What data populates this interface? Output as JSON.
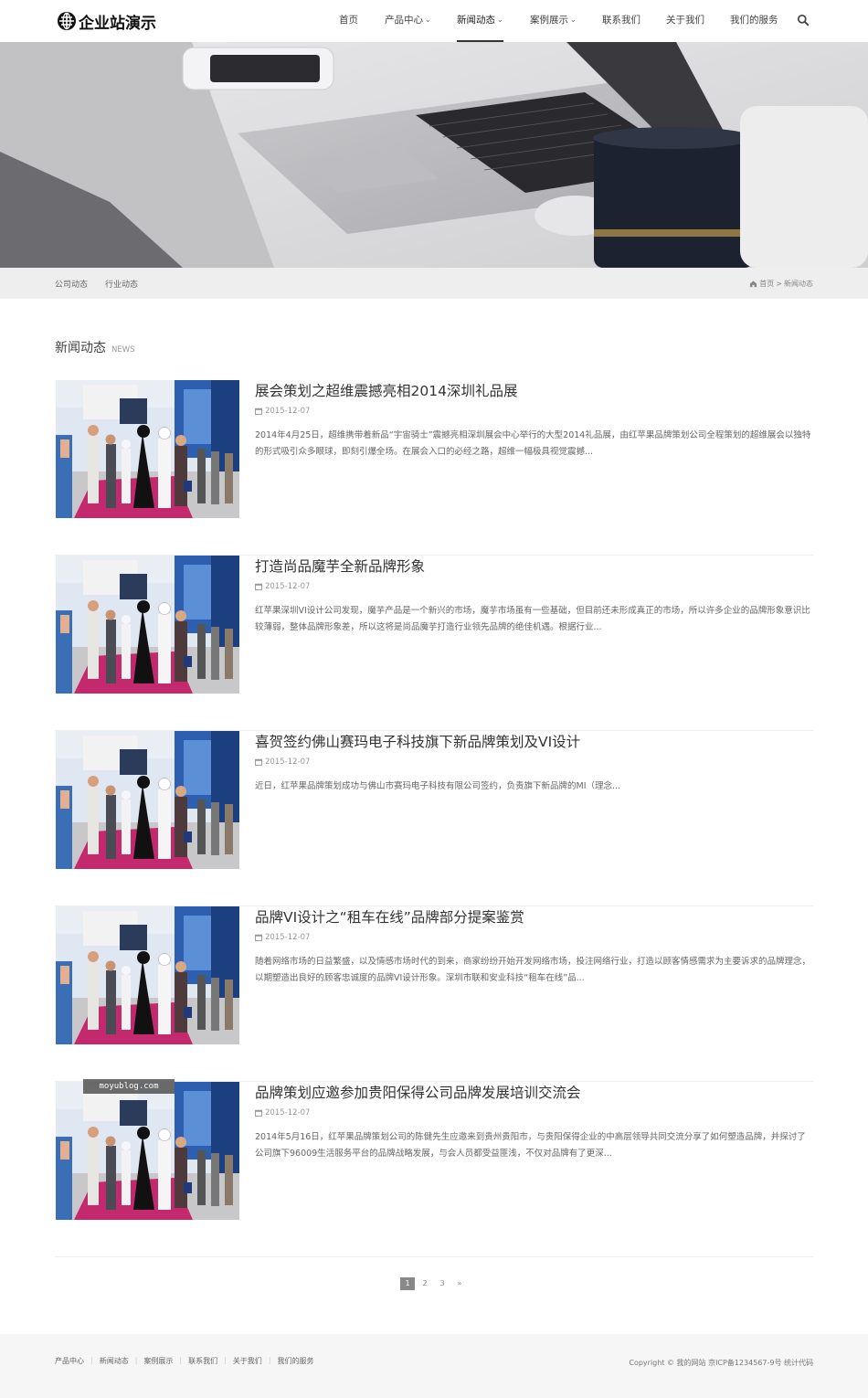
{
  "header": {
    "logo_text": "企业站演示",
    "nav": [
      {
        "label": "首页",
        "dropdown": false,
        "active": false
      },
      {
        "label": "产品中心",
        "dropdown": true,
        "active": false
      },
      {
        "label": "新闻动态",
        "dropdown": true,
        "active": true
      },
      {
        "label": "案例展示",
        "dropdown": true,
        "active": false
      },
      {
        "label": "联系我们",
        "dropdown": false,
        "active": false
      },
      {
        "label": "关于我们",
        "dropdown": false,
        "active": false
      },
      {
        "label": "我们的服务",
        "dropdown": false,
        "active": false
      }
    ],
    "search_icon": "search-icon"
  },
  "subnav": {
    "links": [
      "公司动态",
      "行业动态"
    ],
    "breadcrumb": {
      "home": "首页",
      "separator": ">",
      "current": "新闻动态"
    }
  },
  "section": {
    "title": "新闻动态",
    "title_en": "NEWS"
  },
  "news": [
    {
      "title": "展会策划之超维震撼亮相2014深圳礼品展",
      "date": "2015-12-07",
      "desc": "2014年4月25日，超维携带着新品“宇宙骑士”震撼亮相深圳展会中心举行的大型2014礼品展，由红苹果品牌策划公司全程策划的超维展会以独特的形式吸引众多眼球，即刻引爆全场。在展会入口的必经之路，超维一幅极具视觉震撼..."
    },
    {
      "title": "打造尚品魔芋全新品牌形象",
      "date": "2015-12-07",
      "desc": "红苹果深圳VI设计公司发现，魔芋产品是一个新兴的市场，魔芋市场虽有一些基础，但目前还未形成真正的市场，所以许多企业的品牌形象意识比较薄弱，整体品牌形象差，所以这将是尚品魔芋打造行业领先品牌的绝佳机遇。根据行业..."
    },
    {
      "title": "喜贺签约佛山赛玛电子科技旗下新品牌策划及VI设计",
      "date": "2015-12-07",
      "desc": "近日，红苹果品牌策划成功与佛山市赛玛电子科技有限公司签约，负责旗下新品牌的MI（理念..."
    },
    {
      "title": "品牌VI设计之“租车在线”品牌部分提案鉴赏",
      "date": "2015-12-07",
      "desc": "随着网络市场的日益繁盛，以及情感市场时代的到来，商家纷纷开始开发网络市场，投注网络行业，打造以顾客情感需求为主要诉求的品牌理念，以期塑造出良好的顾客忠诚度的品牌VI设计形象。深圳市联和安业科技“租车在线”品..."
    },
    {
      "title": "品牌策划应邀参加贵阳保得公司品牌发展培训交流会",
      "date": "2015-12-07",
      "desc": "2014年5月16日，红苹果品牌策划公司的陈健先生应邀来到贵州贵阳市，与贵阳保得企业的中高层领导共同交流分享了如何塑造品牌，并探讨了公司旗下96009生活服务平台的品牌战略发展，与会人员都受益匪浅，不仅对品牌有了更深..."
    }
  ],
  "watermark": "moyublog.com",
  "pagination": {
    "pages": [
      "1",
      "2",
      "3",
      "»"
    ],
    "current": "1"
  },
  "footer": {
    "links": [
      "产品中心",
      "新闻动态",
      "案例展示",
      "联系我们",
      "关于我们",
      "我们的服务"
    ],
    "copyright": "Copyright © 我的网站 京ICP备1234567-9号 统计代码"
  },
  "colors": {
    "accent": "#333333",
    "subbar_bg": "#eeeeee",
    "footer_bg": "#f6f6f6",
    "pagination_active": "#888888"
  }
}
